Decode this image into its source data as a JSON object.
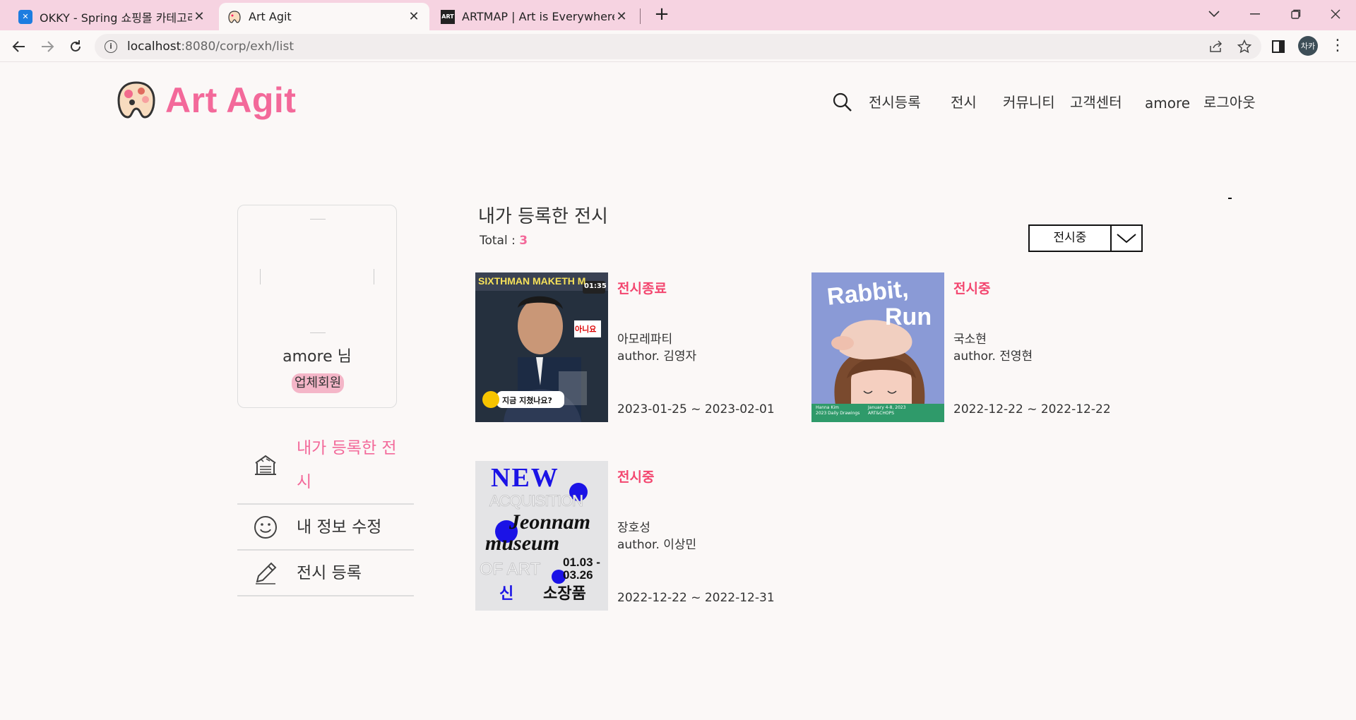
{
  "browser": {
    "tabs": [
      {
        "title": "OKKY - Spring 쇼핑몰 카테고리",
        "close": "✕"
      },
      {
        "title": "Art Agit",
        "close": "✕"
      },
      {
        "title": "ARTMAP | Art is Everywhere",
        "close": "✕"
      }
    ],
    "url_host": "localhost",
    "url_path": ":8080/corp/exh/list",
    "profile_initials": "차카"
  },
  "site": {
    "brand": "Art Agit",
    "nav": [
      "전시등록",
      "전시",
      "커뮤니티",
      "고객센터",
      "amore",
      "로그아웃"
    ]
  },
  "sidebar": {
    "username": "amore 님",
    "role": "업체회원",
    "menu": [
      {
        "label": "내가 등록한 전시",
        "icon": "building-icon",
        "active": true
      },
      {
        "label": "내 정보 수정",
        "icon": "smiley-icon",
        "active": false
      },
      {
        "label": "전시 등록",
        "icon": "pencil-icon",
        "active": false
      }
    ]
  },
  "main": {
    "title": "내가 등록한 전시",
    "total_label": "Total : ",
    "total_count": "3",
    "filter": {
      "selected": "전시중"
    },
    "exhibitions": [
      {
        "status": "전시종료",
        "artist": "아모레파티",
        "author": "author. 김영자",
        "dates": "2023-01-25 ~ 2023-02-01",
        "poster": {
          "top": "SIXTHMAN MAKETH M",
          "badge": "01:35",
          "sticker": "아니요",
          "caption": "지금 지쳤나요?"
        }
      },
      {
        "status": "전시중",
        "artist": "국소현",
        "author": "author. 전영현",
        "dates": "2022-12-22 ~ 2022-12-22",
        "poster": {
          "line1": "Rabbit,",
          "line2": "Run",
          "foot_left": "Hanna Kim\n2023 Daily Drawings",
          "foot_right": "January 4-8, 2023\nART&CHOPS"
        }
      },
      {
        "status": "전시중",
        "artist": "장호성",
        "author": "author. 이상민",
        "dates": "2022-12-22 ~ 2022-12-31",
        "poster": {
          "new": "NEW",
          "acq": "ACQUISITION",
          "l1": "Jeonnam",
          "l2": "museum",
          "l3": "OF ART",
          "date": "01.03 -",
          "date2": "03.26",
          "sin": "신",
          "tag": "소장품"
        }
      }
    ]
  },
  "colors": {
    "brand": "#f3699a",
    "status": "#f3466f",
    "tabbar": "#f6d3e1",
    "page": "#fbf8f7"
  }
}
